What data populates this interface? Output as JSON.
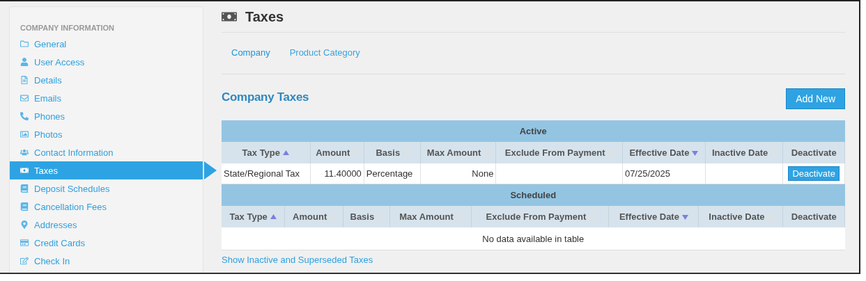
{
  "sidebar": {
    "heading": "COMPANY INFORMATION",
    "items": [
      {
        "label": "General",
        "selected": false
      },
      {
        "label": "User Access",
        "selected": false
      },
      {
        "label": "Details",
        "selected": false
      },
      {
        "label": "Emails",
        "selected": false
      },
      {
        "label": "Phones",
        "selected": false
      },
      {
        "label": "Photos",
        "selected": false
      },
      {
        "label": "Contact Information",
        "selected": false
      },
      {
        "label": "Taxes",
        "selected": true
      },
      {
        "label": "Deposit Schedules",
        "selected": false
      },
      {
        "label": "Cancellation Fees",
        "selected": false
      },
      {
        "label": "Addresses",
        "selected": false
      },
      {
        "label": "Credit Cards",
        "selected": false
      },
      {
        "label": "Check In",
        "selected": false
      }
    ]
  },
  "page_title": "Taxes",
  "tabs": [
    {
      "label": "Company",
      "selected": true
    },
    {
      "label": "Product Category",
      "selected": false
    }
  ],
  "section_title": "Company Taxes",
  "add_button": "Add New",
  "tables": [
    {
      "title": "Active",
      "columns": [
        {
          "label": "Tax Type",
          "sortable": true,
          "sorted": true,
          "descending": false
        },
        {
          "label": "Amount",
          "sortable": true,
          "sorted": false
        },
        {
          "label": "Basis",
          "sortable": true,
          "sorted": false
        },
        {
          "label": "Max Amount",
          "sortable": true,
          "sorted": false
        },
        {
          "label": "Exclude From Payment",
          "sortable": true,
          "sorted": false
        },
        {
          "label": "Effective Date",
          "sortable": true,
          "sorted": true,
          "descending": true
        },
        {
          "label": "Inactive Date",
          "sortable": true,
          "sorted": false
        },
        {
          "label": "Deactivate",
          "sortable": false
        }
      ],
      "rows": [
        {
          "cells": [
            "State/Regional Tax",
            "11.40000",
            "Percentage",
            "None",
            "",
            "07/25/2025",
            ""
          ],
          "action": "Deactivate"
        }
      ]
    },
    {
      "title": "Scheduled",
      "columns": [
        {
          "label": "Tax Type",
          "sortable": true,
          "sorted": true,
          "descending": false
        },
        {
          "label": "Amount",
          "sortable": true,
          "sorted": false
        },
        {
          "label": "Basis",
          "sortable": true,
          "sorted": false
        },
        {
          "label": "Max Amount",
          "sortable": true,
          "sorted": false
        },
        {
          "label": "Exclude From Payment",
          "sortable": true,
          "sorted": false
        },
        {
          "label": "Effective Date",
          "sortable": true,
          "sorted": true,
          "descending": true
        },
        {
          "label": "Inactive Date",
          "sortable": true,
          "sorted": false
        },
        {
          "label": "Deactivate",
          "sortable": false
        }
      ],
      "empty": "No data available in table"
    }
  ],
  "footer_link": "Show Inactive and Superseded Taxes"
}
